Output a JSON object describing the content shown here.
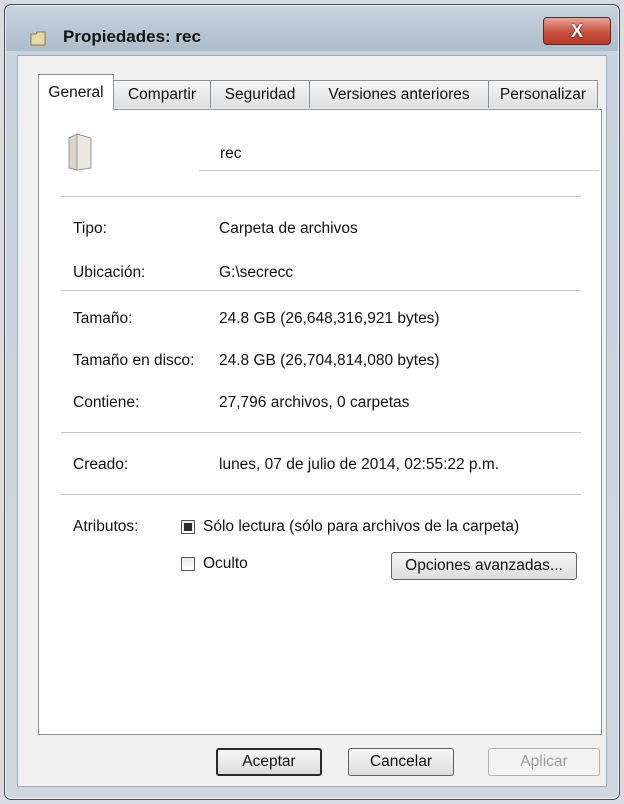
{
  "window": {
    "title": "Propiedades: rec",
    "close_glyph": "X"
  },
  "tabs": [
    {
      "label": "General",
      "active": true
    },
    {
      "label": "Compartir"
    },
    {
      "label": "Seguridad"
    },
    {
      "label": "Versiones anteriores"
    },
    {
      "label": "Personalizar"
    }
  ],
  "general": {
    "folder_name": "rec",
    "type_label": "Tipo:",
    "type_value": "Carpeta de archivos",
    "location_label": "Ubicación:",
    "location_value": "G:\\secrecc",
    "size_label": "Tamaño:",
    "size_value": "24.8 GB (26,648,316,921 bytes)",
    "disk_size_label": "Tamaño en disco:",
    "disk_size_value": "24.8 GB (26,704,814,080 bytes)",
    "contains_label": "Contiene:",
    "contains_value": "27,796 archivos, 0 carpetas",
    "created_label": "Creado:",
    "created_value": "lunes, 07 de julio de 2014, 02:55:22 p.m.",
    "attributes_label": "Atributos:",
    "readonly_label": "Sólo lectura (sólo para archivos de la carpeta)",
    "hidden_label": "Oculto",
    "advanced_button": "Opciones avanzadas..."
  },
  "buttons": {
    "ok": "Aceptar",
    "cancel": "Cancelar",
    "apply": "Aplicar"
  },
  "icons": {
    "title": "folder-icon",
    "close": "close-icon",
    "item": "folder-icon"
  }
}
